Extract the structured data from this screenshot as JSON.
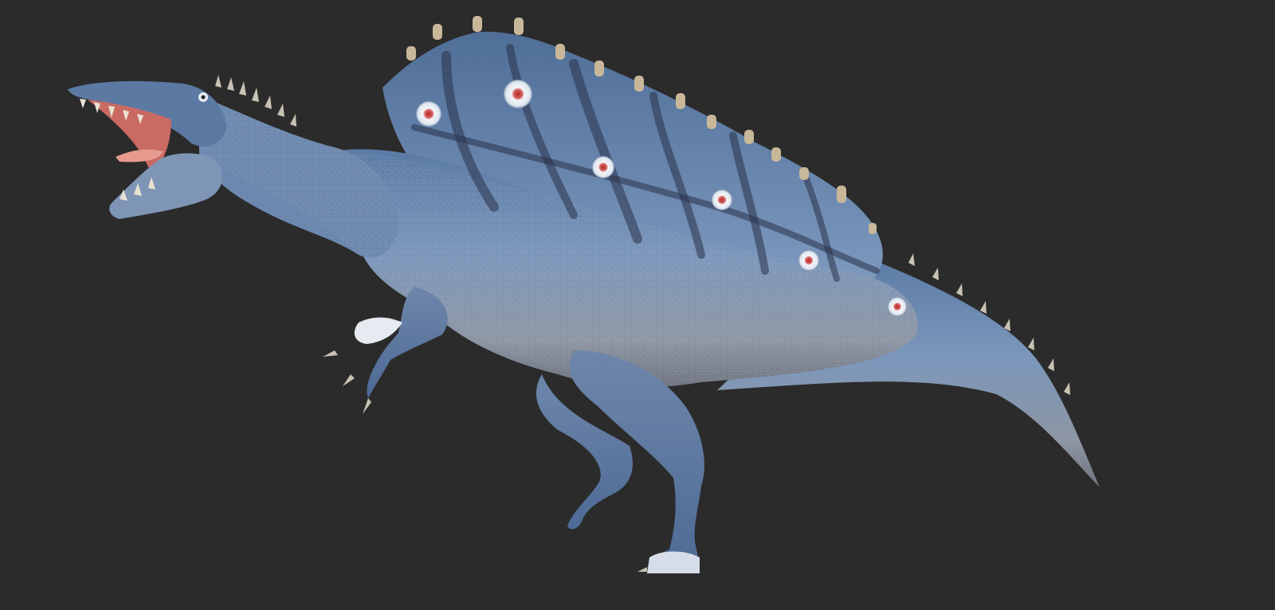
{
  "scene": {
    "background_color": "#2b2b2b",
    "subject": "spinosaurus-render",
    "colors": {
      "skin_base": "#5f7ea6",
      "skin_dark": "#3b4e6e",
      "skin_light": "#a9bcd3",
      "belly": "#8b9098",
      "stripe": "#2a3148",
      "spine_tip": "#c9b79a",
      "mouth": "#c96a63",
      "tongue": "#e79a8e",
      "eyespot_ring": "#e9eef5",
      "eyespot_center": "#b52a2a",
      "claw": "#c8c2b4"
    }
  }
}
